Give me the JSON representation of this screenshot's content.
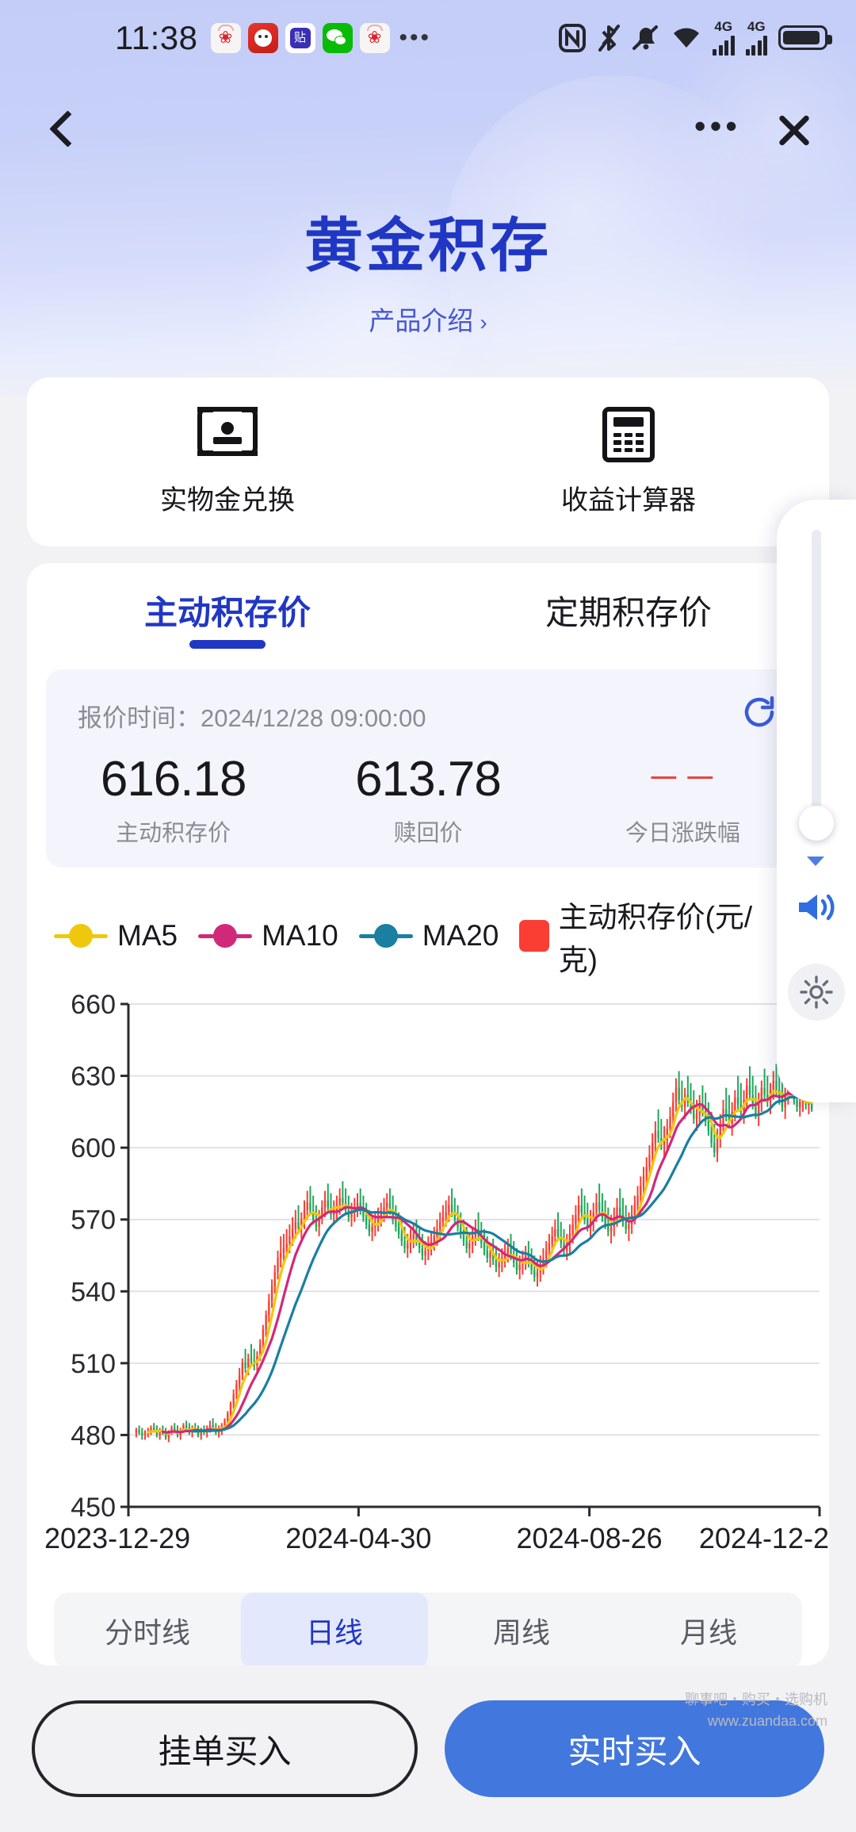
{
  "status_bar": {
    "time": "11:38",
    "app_icons": [
      "huawei-icon",
      "redpacket-icon",
      "tieba-icon",
      "wechat-icon",
      "huawei-icon"
    ],
    "overflow_dots": "•••",
    "indicators": [
      "nfc-icon",
      "bluetooth-off-icon",
      "mute-bell-icon",
      "wifi-icon",
      "signal-4g-icon",
      "signal-4g-icon",
      "battery-icon"
    ],
    "network_label_1": "4G",
    "network_label_2": "4G"
  },
  "nav": {
    "back": "back-arrow",
    "more": "•••",
    "close": "×"
  },
  "header": {
    "title": "黄金积存",
    "subtitle": "产品介绍",
    "subtitle_chevron": "›"
  },
  "quick_actions": [
    {
      "label": "实物金兑换",
      "icon": "wallet-icon"
    },
    {
      "label": "收益计算器",
      "icon": "calculator-icon"
    }
  ],
  "price_tabs": [
    {
      "label": "主动积存价",
      "selected": true
    },
    {
      "label": "定期积存价",
      "selected": false
    }
  ],
  "quote": {
    "time_label": "报价时间：",
    "time_value": "2024/12/28 09:00:00",
    "refresh_icon": "refresh-icon",
    "columns": [
      {
        "value": "616.18",
        "label": "主动积存价",
        "flat": false
      },
      {
        "value": "613.78",
        "label": "赎回价",
        "flat": false
      },
      {
        "value": "－－",
        "label": "今日涨跌幅",
        "flat": true
      }
    ]
  },
  "legend": [
    {
      "name": "MA5",
      "color": "#EFC80D",
      "shape": "line-dot"
    },
    {
      "name": "MA10",
      "color": "#D12979",
      "shape": "line-dot"
    },
    {
      "name": "MA20",
      "color": "#1A7FA0",
      "shape": "line-dot"
    },
    {
      "name": "主动积存价(元/克)",
      "color": "#FA3E34",
      "shape": "square"
    }
  ],
  "legend_info_icon": "info-icon",
  "period_tabs": [
    {
      "label": "分时线",
      "selected": false
    },
    {
      "label": "日线",
      "selected": true
    },
    {
      "label": "周线",
      "selected": false
    },
    {
      "label": "月线",
      "selected": false
    }
  ],
  "bottom_buttons": [
    {
      "label": "挂单买入",
      "style": "ghost"
    },
    {
      "label": "实时买入",
      "style": "solid"
    }
  ],
  "side_widget": {
    "scroll_handle": "scroll-knob",
    "speaker_icon": "speaker-icon",
    "gear_icon": "gear-icon"
  },
  "watermark": [
    "聊事吧・购买・选购机",
    "www.zuandaa.com"
  ],
  "colors": {
    "brand_blue": "#2037C4",
    "accent_blue": "#4277DD",
    "up_red": "#FA3E34",
    "down_green": "#1FA85C",
    "ma5": "#EFC80D",
    "ma10": "#D12979",
    "ma20": "#1A7FA0",
    "header_gradient_top": "#C3CDF7"
  },
  "chart_data": {
    "type": "candlestick",
    "title": "",
    "xlabel": "",
    "ylabel": "",
    "ylim": [
      450,
      660
    ],
    "yticks": [
      660,
      630,
      600,
      570,
      540,
      510,
      480,
      450
    ],
    "xticks": [
      "2023-12-29",
      "2024-04-30",
      "2024-08-26",
      "2024-12-2"
    ],
    "xtick_positions": [
      0,
      0.333,
      0.667,
      1.0
    ],
    "grid": true,
    "series": [
      {
        "name": "MA5",
        "color": "#EFC80D"
      },
      {
        "name": "MA10",
        "color": "#D12979"
      },
      {
        "name": "MA20",
        "color": "#1A7FA0"
      },
      {
        "name": "主动积存价(元/克)",
        "color": "#FA3E34"
      }
    ],
    "up_color": "#FA3E34",
    "down_color": "#1FA85C",
    "candles": [
      [
        481,
        483,
        479,
        482
      ],
      [
        482,
        484,
        480,
        481
      ],
      [
        481,
        483,
        478,
        480
      ],
      [
        480,
        482,
        478,
        481
      ],
      [
        481,
        483,
        479,
        482
      ],
      [
        482,
        484,
        480,
        483
      ],
      [
        483,
        485,
        481,
        482
      ],
      [
        482,
        484,
        479,
        480
      ],
      [
        480,
        483,
        478,
        482
      ],
      [
        482,
        484,
        480,
        481
      ],
      [
        481,
        483,
        478,
        479
      ],
      [
        479,
        482,
        477,
        481
      ],
      [
        481,
        484,
        480,
        483
      ],
      [
        483,
        485,
        481,
        482
      ],
      [
        482,
        484,
        479,
        480
      ],
      [
        480,
        483,
        478,
        482
      ],
      [
        482,
        485,
        481,
        484
      ],
      [
        484,
        486,
        482,
        483
      ],
      [
        483,
        485,
        480,
        481
      ],
      [
        481,
        484,
        479,
        483
      ],
      [
        483,
        485,
        481,
        482
      ],
      [
        482,
        484,
        479,
        480
      ],
      [
        480,
        483,
        478,
        482
      ],
      [
        482,
        484,
        480,
        481
      ],
      [
        481,
        484,
        479,
        483
      ],
      [
        483,
        486,
        481,
        484
      ],
      [
        484,
        487,
        482,
        483
      ],
      [
        483,
        485,
        480,
        481
      ],
      [
        481,
        484,
        479,
        482
      ],
      [
        482,
        485,
        480,
        484
      ],
      [
        484,
        487,
        482,
        486
      ],
      [
        486,
        490,
        484,
        489
      ],
      [
        489,
        494,
        487,
        493
      ],
      [
        493,
        499,
        491,
        497
      ],
      [
        497,
        503,
        495,
        501
      ],
      [
        501,
        508,
        498,
        505
      ],
      [
        505,
        512,
        503,
        510
      ],
      [
        510,
        516,
        506,
        508
      ],
      [
        508,
        514,
        505,
        512
      ],
      [
        512,
        518,
        509,
        511
      ],
      [
        511,
        516,
        507,
        509
      ],
      [
        509,
        515,
        506,
        513
      ],
      [
        513,
        520,
        511,
        518
      ],
      [
        518,
        526,
        515,
        524
      ],
      [
        524,
        532,
        521,
        530
      ],
      [
        530,
        539,
        527,
        536
      ],
      [
        536,
        545,
        533,
        542
      ],
      [
        542,
        551,
        539,
        548
      ],
      [
        548,
        557,
        545,
        554
      ],
      [
        554,
        563,
        550,
        556
      ],
      [
        556,
        564,
        552,
        558
      ],
      [
        558,
        566,
        554,
        560
      ],
      [
        560,
        568,
        556,
        563
      ],
      [
        563,
        571,
        559,
        566
      ],
      [
        566,
        574,
        562,
        569
      ],
      [
        569,
        576,
        564,
        566
      ],
      [
        566,
        573,
        562,
        570
      ],
      [
        570,
        578,
        566,
        574
      ],
      [
        574,
        582,
        570,
        577
      ],
      [
        577,
        584,
        572,
        574
      ],
      [
        574,
        580,
        568,
        570
      ],
      [
        570,
        576,
        565,
        567
      ],
      [
        567,
        574,
        563,
        571
      ],
      [
        571,
        578,
        568,
        575
      ],
      [
        575,
        582,
        571,
        578
      ],
      [
        578,
        585,
        573,
        575
      ],
      [
        575,
        581,
        570,
        572
      ],
      [
        572,
        578,
        568,
        574
      ],
      [
        574,
        580,
        570,
        576
      ],
      [
        576,
        583,
        572,
        579
      ],
      [
        579,
        586,
        575,
        577
      ],
      [
        577,
        583,
        572,
        574
      ],
      [
        574,
        580,
        569,
        571
      ],
      [
        571,
        577,
        567,
        573
      ],
      [
        573,
        579,
        569,
        575
      ],
      [
        575,
        581,
        571,
        577
      ],
      [
        577,
        583,
        572,
        574
      ],
      [
        574,
        580,
        569,
        571
      ],
      [
        571,
        577,
        566,
        568
      ],
      [
        568,
        574,
        563,
        565
      ],
      [
        565,
        571,
        561,
        567
      ],
      [
        567,
        573,
        563,
        569
      ],
      [
        569,
        575,
        565,
        571
      ],
      [
        571,
        577,
        567,
        573
      ],
      [
        573,
        579,
        569,
        575
      ],
      [
        575,
        581,
        571,
        577
      ],
      [
        577,
        583,
        572,
        574
      ],
      [
        574,
        580,
        568,
        570
      ],
      [
        570,
        576,
        565,
        567
      ],
      [
        567,
        573,
        562,
        564
      ],
      [
        564,
        570,
        559,
        561
      ],
      [
        561,
        567,
        556,
        558
      ],
      [
        558,
        564,
        554,
        560
      ],
      [
        560,
        566,
        556,
        562
      ],
      [
        562,
        568,
        558,
        564
      ],
      [
        564,
        570,
        559,
        561
      ],
      [
        561,
        567,
        556,
        558
      ],
      [
        558,
        564,
        553,
        555
      ],
      [
        555,
        561,
        551,
        557
      ],
      [
        557,
        563,
        553,
        559
      ],
      [
        559,
        565,
        555,
        561
      ],
      [
        561,
        567,
        557,
        563
      ],
      [
        563,
        570,
        559,
        566
      ],
      [
        566,
        573,
        562,
        569
      ],
      [
        569,
        576,
        565,
        571
      ],
      [
        571,
        578,
        567,
        573
      ],
      [
        573,
        580,
        569,
        576
      ],
      [
        576,
        583,
        571,
        573
      ],
      [
        573,
        579,
        568,
        570
      ],
      [
        570,
        576,
        565,
        567
      ],
      [
        567,
        573,
        562,
        564
      ],
      [
        564,
        570,
        559,
        561
      ],
      [
        561,
        567,
        556,
        558
      ],
      [
        558,
        564,
        554,
        560
      ],
      [
        560,
        567,
        556,
        563
      ],
      [
        563,
        570,
        559,
        566
      ],
      [
        566,
        573,
        561,
        563
      ],
      [
        563,
        569,
        558,
        560
      ],
      [
        560,
        566,
        555,
        557
      ],
      [
        557,
        563,
        552,
        554
      ],
      [
        554,
        560,
        550,
        556
      ],
      [
        556,
        562,
        551,
        553
      ],
      [
        553,
        559,
        548,
        550
      ],
      [
        550,
        556,
        546,
        552
      ],
      [
        552,
        558,
        548,
        554
      ],
      [
        554,
        560,
        550,
        556
      ],
      [
        556,
        562,
        552,
        558
      ],
      [
        558,
        564,
        553,
        555
      ],
      [
        555,
        561,
        550,
        552
      ],
      [
        552,
        558,
        547,
        549
      ],
      [
        549,
        555,
        545,
        551
      ],
      [
        551,
        557,
        547,
        553
      ],
      [
        553,
        559,
        549,
        555
      ],
      [
        555,
        561,
        550,
        552
      ],
      [
        552,
        558,
        547,
        549
      ],
      [
        549,
        555,
        544,
        546
      ],
      [
        546,
        553,
        542,
        548
      ],
      [
        548,
        555,
        544,
        551
      ],
      [
        551,
        558,
        547,
        554
      ],
      [
        554,
        561,
        550,
        557
      ],
      [
        557,
        564,
        553,
        560
      ],
      [
        560,
        567,
        556,
        563
      ],
      [
        563,
        570,
        559,
        566
      ],
      [
        566,
        573,
        561,
        563
      ],
      [
        563,
        569,
        558,
        560
      ],
      [
        560,
        566,
        555,
        557
      ],
      [
        557,
        564,
        553,
        560
      ],
      [
        560,
        568,
        556,
        564
      ],
      [
        564,
        572,
        560,
        568
      ],
      [
        568,
        576,
        564,
        572
      ],
      [
        572,
        580,
        568,
        576
      ],
      [
        576,
        583,
        571,
        573
      ],
      [
        573,
        580,
        568,
        570
      ],
      [
        570,
        577,
        565,
        567
      ],
      [
        567,
        574,
        562,
        569
      ],
      [
        569,
        577,
        565,
        573
      ],
      [
        573,
        581,
        569,
        577
      ],
      [
        577,
        585,
        572,
        574
      ],
      [
        574,
        581,
        569,
        571
      ],
      [
        571,
        578,
        566,
        568
      ],
      [
        568,
        575,
        563,
        565
      ],
      [
        565,
        572,
        560,
        567
      ],
      [
        567,
        575,
        563,
        571
      ],
      [
        571,
        579,
        567,
        575
      ],
      [
        575,
        583,
        570,
        572
      ],
      [
        572,
        579,
        567,
        569
      ],
      [
        569,
        576,
        564,
        566
      ],
      [
        566,
        573,
        561,
        568
      ],
      [
        568,
        576,
        564,
        572
      ],
      [
        572,
        580,
        568,
        576
      ],
      [
        576,
        584,
        572,
        580
      ],
      [
        580,
        588,
        576,
        584
      ],
      [
        584,
        592,
        580,
        588
      ],
      [
        588,
        596,
        584,
        592
      ],
      [
        592,
        601,
        588,
        597
      ],
      [
        597,
        606,
        593,
        602
      ],
      [
        602,
        611,
        598,
        607
      ],
      [
        607,
        616,
        602,
        604
      ],
      [
        604,
        612,
        599,
        601
      ],
      [
        601,
        609,
        596,
        603
      ],
      [
        603,
        612,
        599,
        608
      ],
      [
        608,
        617,
        604,
        613
      ],
      [
        613,
        623,
        609,
        619
      ],
      [
        619,
        629,
        615,
        625
      ],
      [
        625,
        632,
        618,
        620
      ],
      [
        620,
        628,
        615,
        617
      ],
      [
        617,
        625,
        612,
        622
      ],
      [
        622,
        630,
        617,
        619
      ],
      [
        619,
        627,
        614,
        616
      ],
      [
        616,
        624,
        610,
        612
      ],
      [
        612,
        620,
        607,
        614
      ],
      [
        614,
        622,
        610,
        618
      ],
      [
        618,
        626,
        613,
        615
      ],
      [
        615,
        623,
        609,
        611
      ],
      [
        611,
        619,
        605,
        607
      ],
      [
        607,
        615,
        600,
        602
      ],
      [
        602,
        610,
        596,
        598
      ],
      [
        598,
        608,
        594,
        604
      ],
      [
        604,
        614,
        600,
        610
      ],
      [
        610,
        620,
        606,
        616
      ],
      [
        616,
        625,
        611,
        613
      ],
      [
        613,
        622,
        608,
        610
      ],
      [
        610,
        619,
        605,
        615
      ],
      [
        615,
        624,
        611,
        621
      ],
      [
        621,
        630,
        616,
        618
      ],
      [
        618,
        627,
        613,
        615
      ],
      [
        615,
        624,
        610,
        620
      ],
      [
        620,
        629,
        616,
        626
      ],
      [
        626,
        634,
        620,
        622
      ],
      [
        622,
        630,
        616,
        618
      ],
      [
        618,
        626,
        612,
        614
      ],
      [
        614,
        623,
        609,
        619
      ],
      [
        619,
        628,
        615,
        625
      ],
      [
        625,
        633,
        620,
        622
      ],
      [
        622,
        630,
        617,
        619
      ],
      [
        619,
        627,
        614,
        624
      ],
      [
        624,
        632,
        620,
        628
      ],
      [
        628,
        635,
        622,
        624
      ],
      [
        624,
        632,
        618,
        620
      ],
      [
        620,
        628,
        615,
        617
      ],
      [
        617,
        625,
        612,
        622
      ],
      [
        622,
        630,
        618,
        626
      ],
      [
        626,
        633,
        621,
        623
      ],
      [
        623,
        630,
        618,
        620
      ],
      [
        620,
        627,
        615,
        617
      ],
      [
        617,
        624,
        613,
        619
      ],
      [
        619,
        626,
        615,
        621
      ],
      [
        621,
        627,
        616,
        618
      ],
      [
        618,
        625,
        614,
        620
      ],
      [
        620,
        626,
        615,
        616
      ]
    ]
  }
}
